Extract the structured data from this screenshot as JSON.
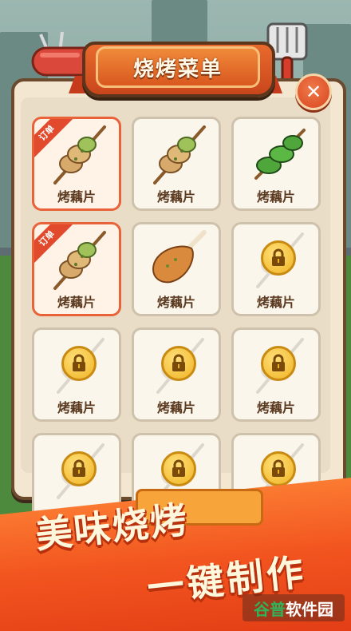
{
  "title": "烧烤菜单",
  "close_symbol": "✕",
  "tag_label": "订单",
  "items": [
    {
      "label": "烤藕片",
      "state": "ordered",
      "food": "skewer-icon"
    },
    {
      "label": "烤藕片",
      "state": "available",
      "food": "skewer-icon"
    },
    {
      "label": "烤藕片",
      "state": "available",
      "food": "green-pepper-skewer-icon"
    },
    {
      "label": "烤藕片",
      "state": "ordered",
      "food": "skewer-icon"
    },
    {
      "label": "烤藕片",
      "state": "available",
      "food": "chicken-leg-icon"
    },
    {
      "label": "烤藕片",
      "state": "locked",
      "food": "lock-icon"
    },
    {
      "label": "烤藕片",
      "state": "locked",
      "food": "lock-icon"
    },
    {
      "label": "烤藕片",
      "state": "locked",
      "food": "lock-icon"
    },
    {
      "label": "烤藕片",
      "state": "locked",
      "food": "lock-icon"
    },
    {
      "label": "",
      "state": "locked",
      "food": "lock-icon"
    },
    {
      "label": "",
      "state": "locked",
      "food": "lock-icon"
    },
    {
      "label": "",
      "state": "locked",
      "food": "lock-icon"
    }
  ],
  "promo": {
    "line1": "美味烧烤",
    "line2": "一键制作"
  },
  "watermark": {
    "part1": "谷普",
    "part2": "软件园"
  },
  "colors": {
    "accent": "#e8623a",
    "panel": "#f3e7d2",
    "frame": "#6b4a2e",
    "lock": "#f0b323",
    "promo": "#f2541f"
  }
}
